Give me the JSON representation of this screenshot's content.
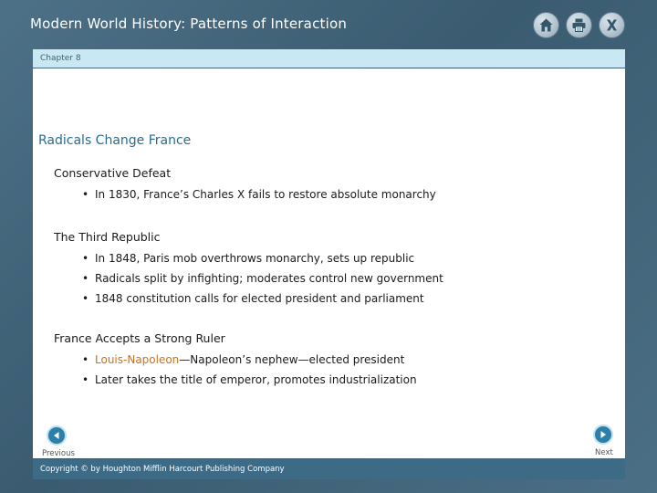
{
  "header": {
    "title": "Modern World History: Patterns of Interaction",
    "icons": [
      "home-icon",
      "print-icon",
      "close-icon"
    ]
  },
  "chapter": {
    "label": "Chapter 8"
  },
  "slide": {
    "title": "Radicals Change France",
    "sections": [
      {
        "heading": "Conservative  Defeat",
        "bullets": [
          "In 1830, France’s Charles X fails to restore absolute monarchy"
        ]
      },
      {
        "heading": "The  Third  Republic",
        "bullets": [
          "In 1848, Paris mob overthrows monarchy, sets up republic",
          "Radicals split by infighting; moderates control new government",
          "1848 constitution calls for elected president and parliament"
        ]
      },
      {
        "heading": "France  Accepts  a Strong Ruler",
        "bullets_rich": [
          {
            "highlight": "Louis-Napoleon",
            "rest": "—Napoleon’s nephew—elected president"
          }
        ],
        "bullets": [
          "Later takes the title of emperor, promotes industrialization"
        ]
      }
    ]
  },
  "navigation": {
    "previous_label": "Previous",
    "next_label": "Next"
  },
  "footer": {
    "copyright": "Copyright © by Houghton Mifflin Harcourt Publishing Company"
  },
  "colors": {
    "background": "#3f6277",
    "title": "#2a6b8f",
    "highlight": "#c8731c",
    "chapter_bar": "#c9e8f3",
    "nav_button": "#2c7fa8"
  }
}
